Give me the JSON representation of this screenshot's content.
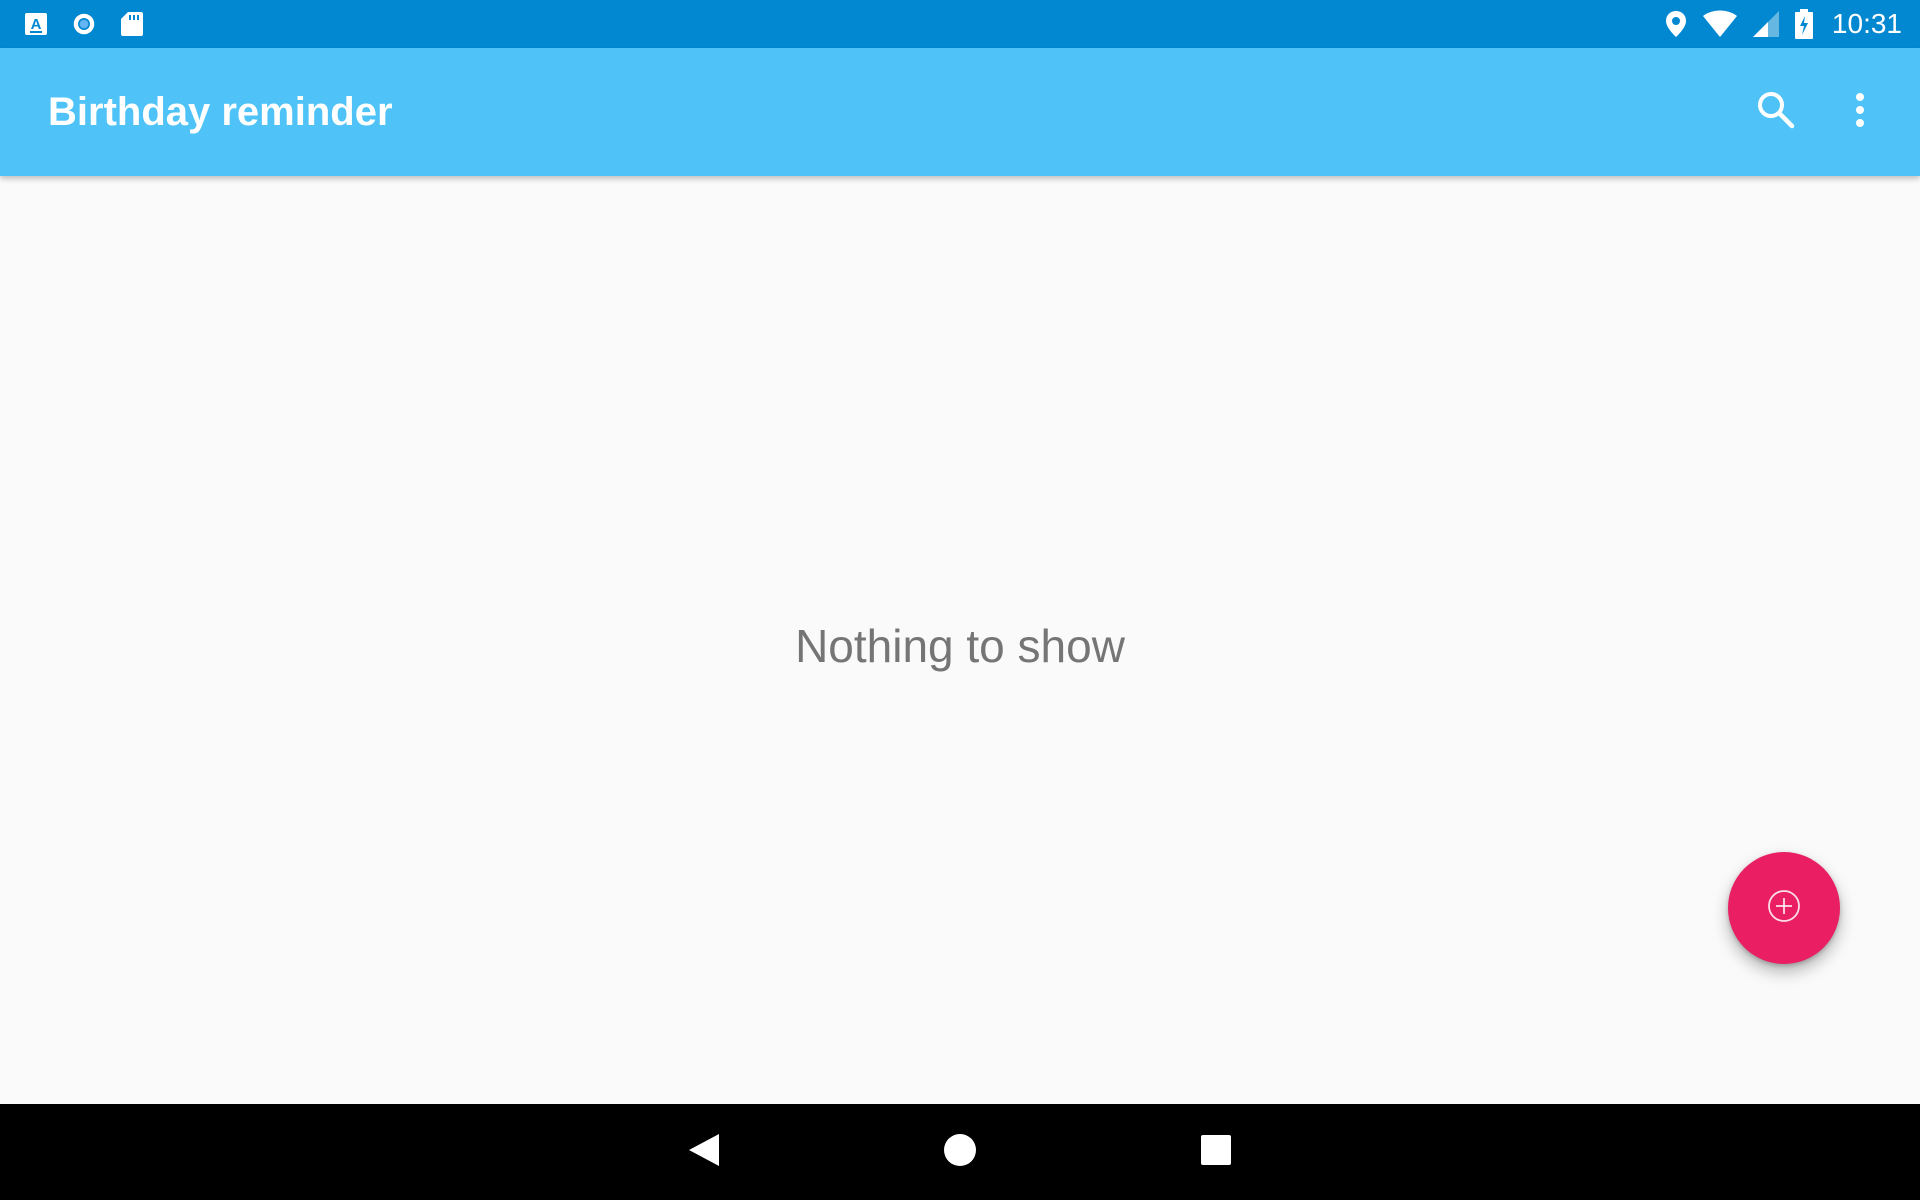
{
  "status_bar": {
    "time": "10:31",
    "left_icons": [
      "keyboard-a-icon",
      "sync-circle-icon",
      "sd-card-icon"
    ],
    "right_icons": [
      "location-icon",
      "wifi-icon",
      "cell-signal-icon",
      "battery-charging-icon"
    ],
    "background": "#0288d1"
  },
  "app_bar": {
    "title": "Birthday reminder",
    "actions": [
      "search-icon",
      "more-vert-icon"
    ],
    "background": "#4fc3f7"
  },
  "content": {
    "empty_message": "Nothing to show"
  },
  "fab": {
    "icon": "add-circle-icon",
    "color": "#e91e63"
  },
  "nav_bar": {
    "buttons": [
      "back-icon",
      "home-icon",
      "recents-icon"
    ]
  }
}
